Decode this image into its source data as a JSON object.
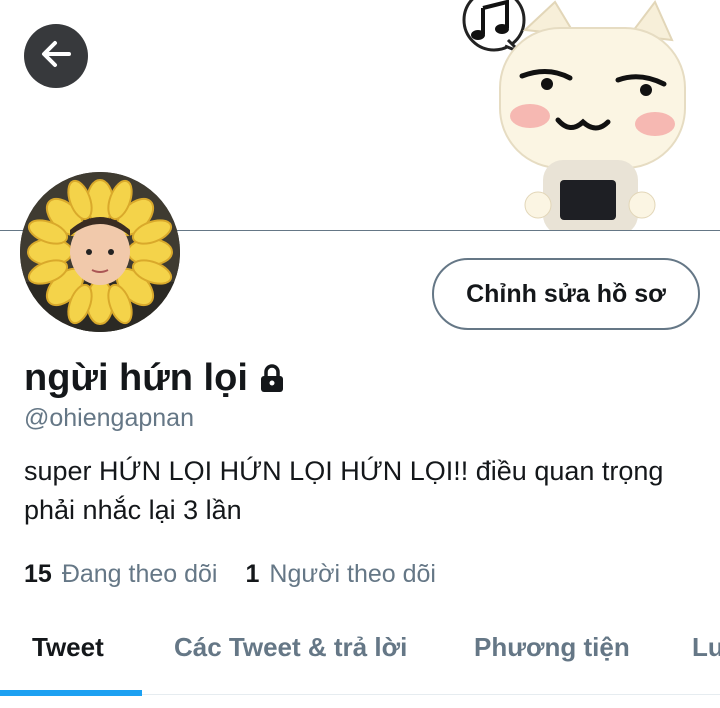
{
  "profile": {
    "display_name": "ngừi hứn lọi",
    "handle": "@ohiengapnan",
    "bio": "super HỨN LỌI HỨN LỌI HỨN LỌI!! điều quan trọng phải nhắc lại 3 lần",
    "edit_button": "Chỉnh sửa hồ sơ",
    "locked_icon": "lock-icon"
  },
  "stats": {
    "following_count": "15",
    "following_label": "Đang theo dõi",
    "followers_count": "1",
    "followers_label": "Người theo dõi"
  },
  "tabs": [
    {
      "label": "Tweet",
      "active": true
    },
    {
      "label": "Các Tweet & trả lời",
      "active": false
    },
    {
      "label": "Phương tiện",
      "active": false
    },
    {
      "label": "Lu",
      "active": false
    }
  ],
  "colors": {
    "accent": "#1da1f2",
    "text_primary": "#14171a",
    "text_secondary": "#657786"
  },
  "icons": {
    "back": "arrow-left-icon",
    "lock": "lock-icon",
    "music_bubble": "music-note-icon"
  }
}
